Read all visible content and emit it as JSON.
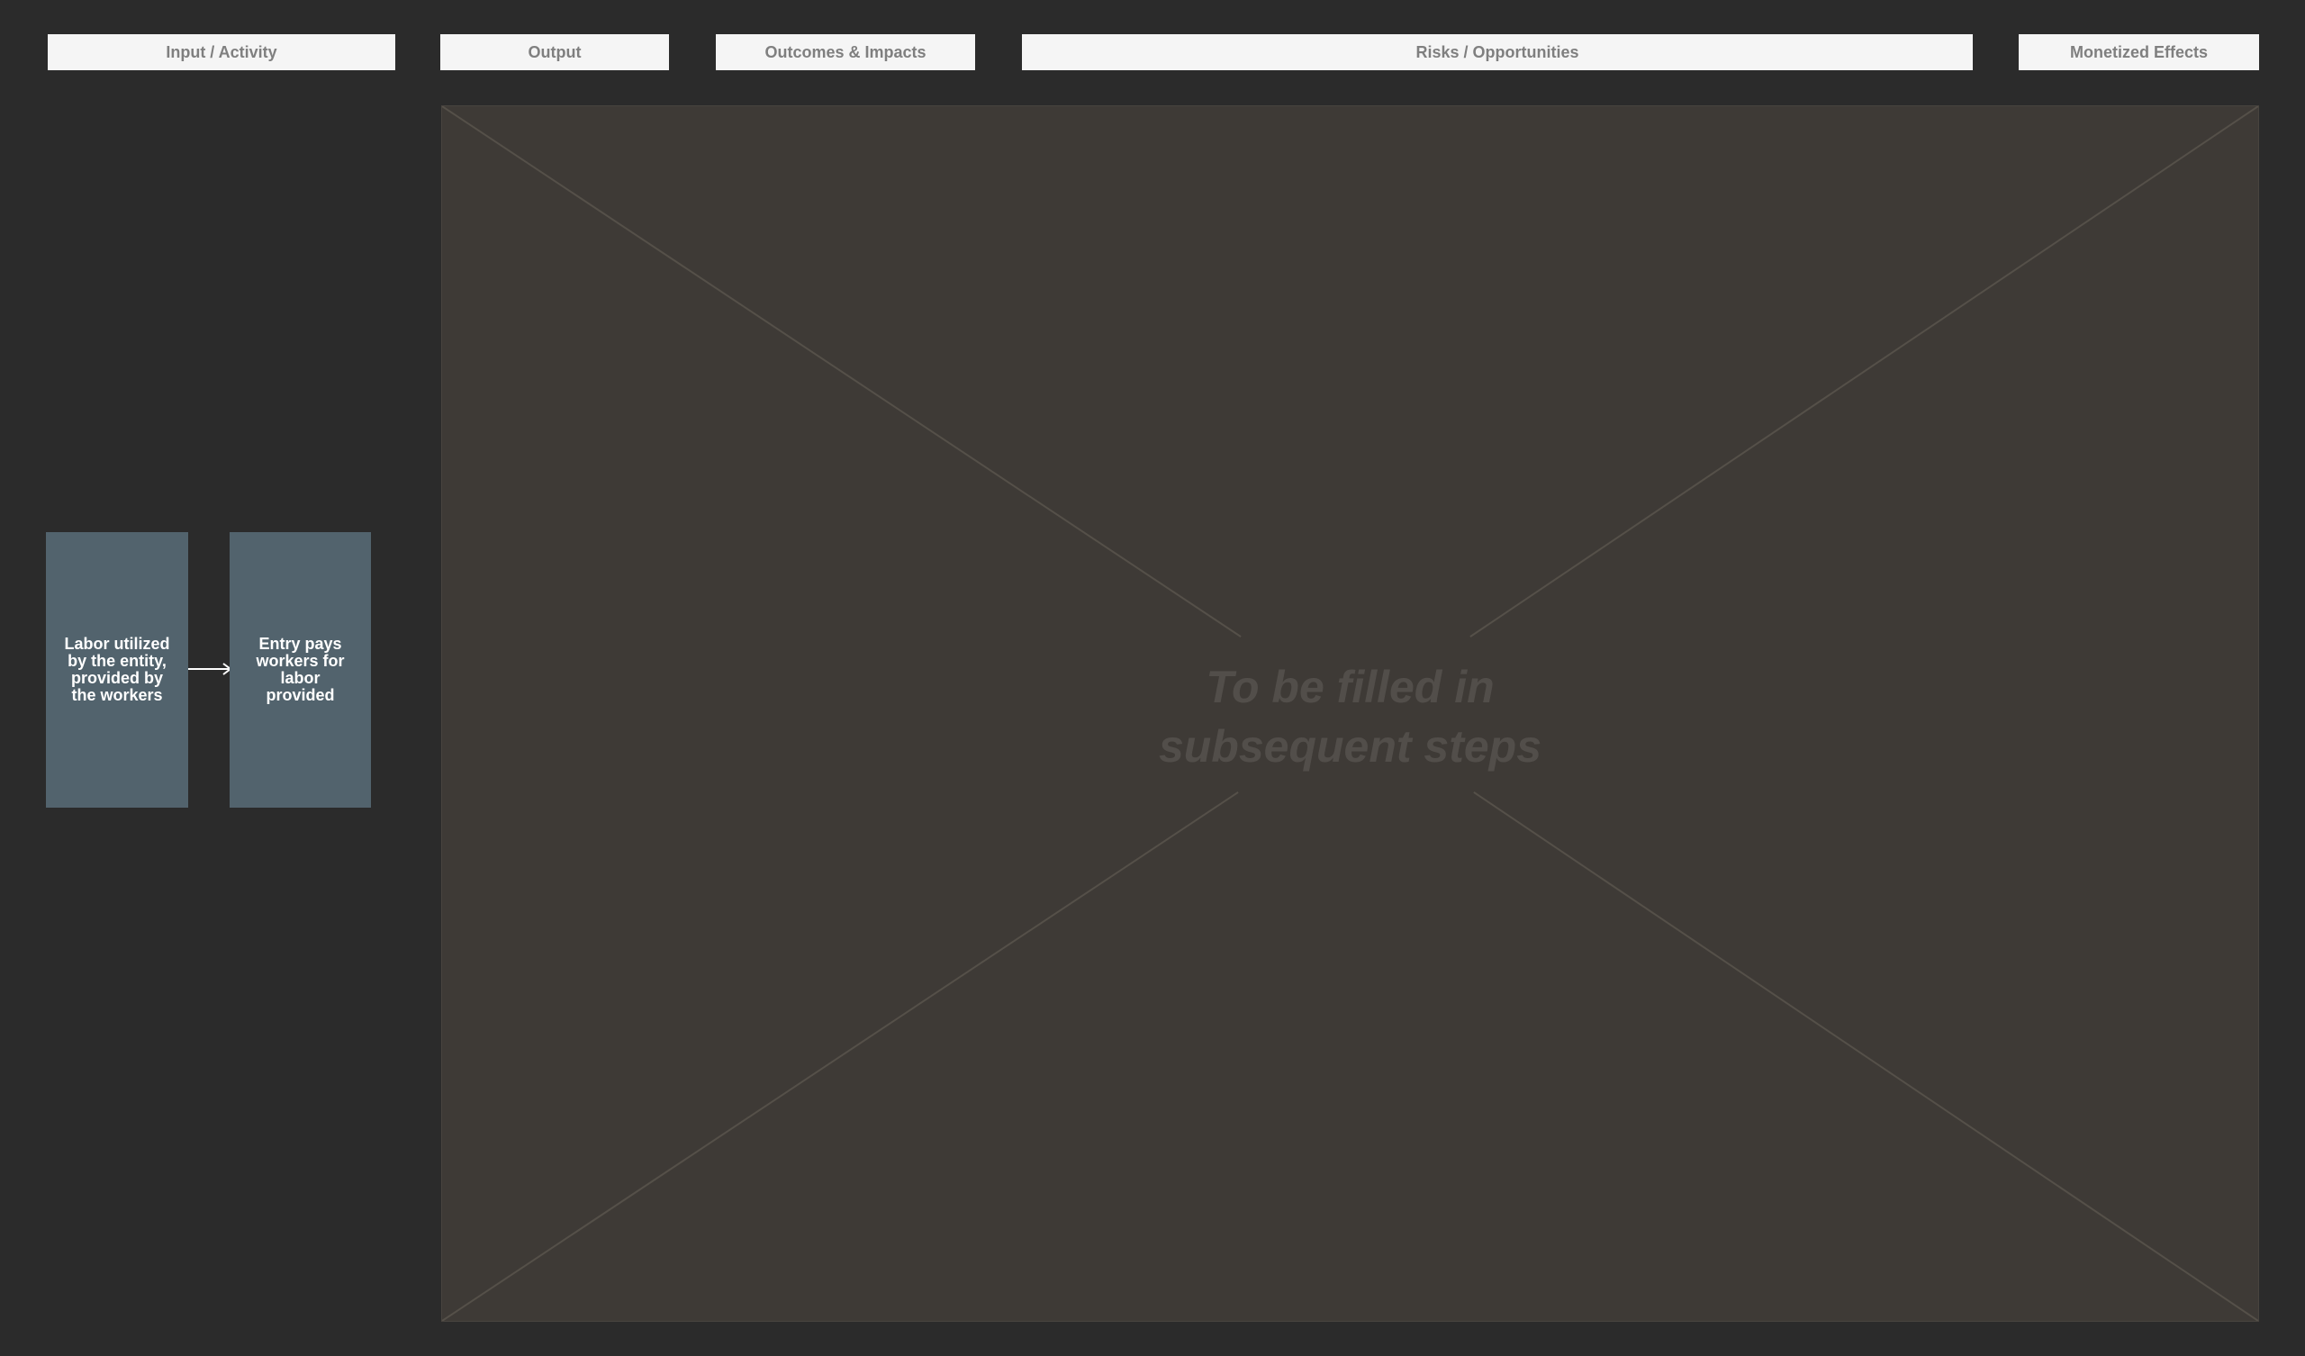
{
  "headers": {
    "input_activity": "Input / Activity",
    "output": "Output",
    "outcomes_impacts": "Outcomes & Impacts",
    "risks_opportunities": "Risks / Opportunities",
    "monetized_effects": "Monetized Effects"
  },
  "placeholder": {
    "line1": "To be filled in",
    "line2": "subsequent steps"
  },
  "nodes": {
    "labor": "Labor utilized by the entity, provided by the workers",
    "pays": "Entry pays workers for labor provided"
  },
  "colors": {
    "background": "#2b2b2b",
    "header_bg": "#f5f5f5",
    "header_text": "#7f7f7f",
    "placeholder_bg": "#3e3a36",
    "placeholder_text": "#524e4a",
    "node_bg": "#52636d",
    "node_text": "#ffffff"
  }
}
